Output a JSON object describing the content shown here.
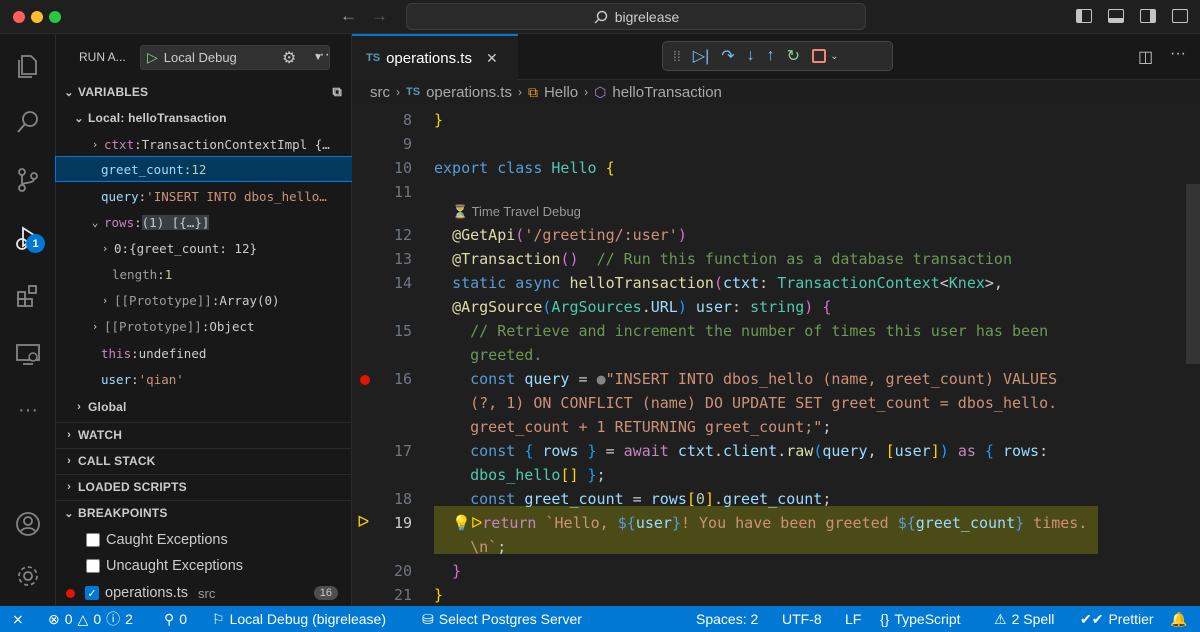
{
  "titlebar": {
    "search_text": "bigrelease"
  },
  "activity": {
    "debug_badge": "1"
  },
  "sidebar": {
    "run_label": "RUN A...",
    "config": "Local Debug",
    "variables_title": "VARIABLES",
    "local_scope": "Local: helloTransaction",
    "vars": [
      {
        "name": "ctxt",
        "value": "TransactionContextImpl {…"
      },
      {
        "name": "greet_count",
        "value": "12"
      },
      {
        "name": "query",
        "value": "'INSERT INTO dbos_hello…"
      },
      {
        "name": "rows",
        "value": "(1) [{…}]"
      },
      {
        "name": "0",
        "value": "{greet_count: 12}"
      },
      {
        "name": "length",
        "value": "1"
      },
      {
        "name": "[[Prototype]]",
        "value": "Array(0)"
      },
      {
        "name": "[[Prototype]]",
        "value": "Object"
      },
      {
        "name": "this",
        "value": "undefined"
      },
      {
        "name": "user",
        "value": "'qian'"
      }
    ],
    "global_scope": "Global",
    "watch": "WATCH",
    "call_stack": "CALL STACK",
    "loaded_scripts": "LOADED SCRIPTS",
    "breakpoints": "BREAKPOINTS",
    "bp_items": [
      {
        "label": "Caught Exceptions",
        "checked": false
      },
      {
        "label": "Uncaught Exceptions",
        "checked": false
      },
      {
        "label": "operations.ts",
        "checked": true,
        "dir": "src",
        "line": "16"
      }
    ]
  },
  "editor": {
    "tab": "operations.ts",
    "tab_lang": "TS",
    "breadcrumb": [
      "src",
      "operations.ts",
      "Hello",
      "helloTransaction"
    ],
    "codelens": "Time Travel Debug",
    "lines": [
      "8",
      "9",
      "10",
      "11",
      "12",
      "13",
      "14",
      "",
      "15",
      "",
      "16",
      "",
      "",
      "17",
      "",
      "18",
      "19",
      "",
      "20",
      "21"
    ]
  },
  "status": {
    "errors": "0",
    "warnings": "0",
    "info": "2",
    "ports": "0",
    "debug": "Local Debug (bigrelease)",
    "db": "Select Postgres Server",
    "spaces": "Spaces: 2",
    "encoding": "UTF-8",
    "eol": "LF",
    "language": "TypeScript",
    "spell": "2 Spell",
    "prettier": "Prettier"
  },
  "colors": {
    "accent": "#0078d4",
    "breakpoint": "#e51400",
    "current_line": "#4b4b18"
  }
}
